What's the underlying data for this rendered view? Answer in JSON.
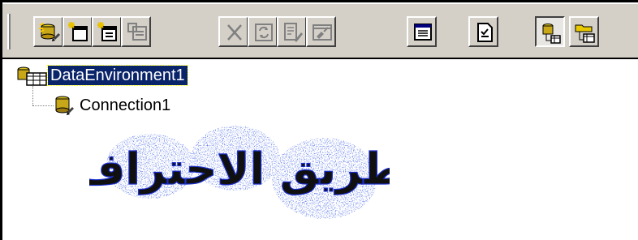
{
  "toolbar": {
    "buttons": [
      {
        "icon": "add-connection-icon",
        "enabled": true
      },
      {
        "icon": "add-command-icon",
        "enabled": true
      },
      {
        "icon": "add-child-command-icon",
        "enabled": true
      },
      {
        "icon": "insert-stored-procedures-icon",
        "enabled": false
      },
      {
        "icon": "delete-icon",
        "enabled": false
      },
      {
        "icon": "refresh-icon",
        "enabled": false
      },
      {
        "icon": "design-icon",
        "enabled": false
      },
      {
        "icon": "properties-icon",
        "enabled": false
      },
      {
        "icon": "view-code-icon",
        "enabled": true
      },
      {
        "icon": "options-icon",
        "enabled": true
      },
      {
        "icon": "arrange-by-connection-icon",
        "enabled": true,
        "pressed": true
      },
      {
        "icon": "arrange-by-object-icon",
        "enabled": true
      }
    ]
  },
  "tree": {
    "root": {
      "label": "DataEnvironment1",
      "selected": true,
      "icon": "data-environment-icon"
    },
    "children": [
      {
        "label": "Connection1",
        "icon": "connection-icon"
      }
    ]
  },
  "watermark": {
    "text": "طريق الاحتراف",
    "color": "#1a2ecc"
  },
  "colors": {
    "toolbar": "#d4d0c8",
    "selection": "#0a246a",
    "background": "#ffffff"
  }
}
